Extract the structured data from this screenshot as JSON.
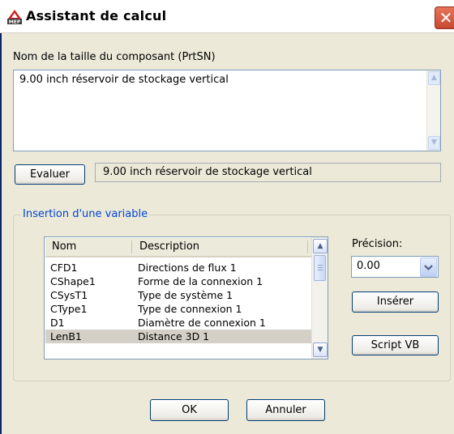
{
  "window": {
    "title": "Assistant de calcul",
    "close_glyph": "✕"
  },
  "size_name": {
    "label": "Nom de la taille du composant (PrtSN)",
    "value": "9.00 inch réservoir de stockage vertical"
  },
  "evaluate": {
    "button_label": "Evaluer",
    "result": "9.00 inch réservoir de stockage vertical"
  },
  "variable_group": {
    "title": "Insertion d'une variable",
    "columns": [
      "Nom",
      "Description"
    ],
    "rows": [
      {
        "name": "CFD1",
        "description": "Directions de flux 1"
      },
      {
        "name": "CShape1",
        "description": "Forme de la connexion 1"
      },
      {
        "name": "CSysT1",
        "description": "Type de système 1"
      },
      {
        "name": "CType1",
        "description": "Type de connexion 1"
      },
      {
        "name": "D1",
        "description": "Diamètre de connexion 1"
      },
      {
        "name": "LenB1",
        "description": "Distance 3D 1"
      }
    ],
    "selected_row": "LenB1",
    "precision_label": "Précision:",
    "precision_value": "0.00",
    "insert_button": "Insérer",
    "script_button": "Script VB"
  },
  "footer": {
    "ok_label": "OK",
    "cancel_label": "Annuler"
  },
  "icons": {
    "app": "autocad-mep-icon",
    "close": "close-icon"
  },
  "colors": {
    "dialog_bg": "#ece9d8",
    "group_title": "#0046d5",
    "close_button": "#d9553a",
    "field_border": "#7f9db9"
  }
}
